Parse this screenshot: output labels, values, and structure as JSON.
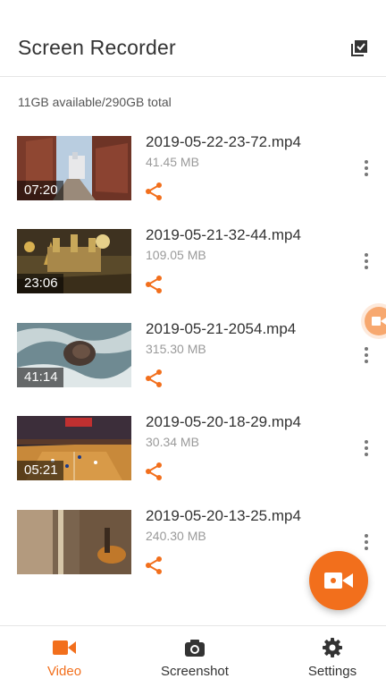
{
  "app": {
    "title": "Screen Recorder"
  },
  "storage": {
    "text": "11GB available/290GB total"
  },
  "videos": [
    {
      "filename": "2019-05-22-23-72.mp4",
      "size": "41.45 MB",
      "duration": "07:20"
    },
    {
      "filename": "2019-05-21-32-44.mp4",
      "size": "109.05 MB",
      "duration": "23:06"
    },
    {
      "filename": "2019-05-21-2054.mp4",
      "size": "315.30 MB",
      "duration": "41:14"
    },
    {
      "filename": "2019-05-20-18-29.mp4",
      "size": "30.34 MB",
      "duration": "05:21"
    },
    {
      "filename": "2019-05-20-13-25.mp4",
      "size": "240.30 MB",
      "duration": ""
    }
  ],
  "nav": {
    "video": "Video",
    "screenshot": "Screenshot",
    "settings": "Settings"
  },
  "colors": {
    "accent": "#f26f1c",
    "text": "#333333",
    "muted": "#9a9a9a"
  },
  "icons": {
    "select": "checkbox-stack-icon",
    "share": "share-icon",
    "more": "more-vertical-icon",
    "fab": "video-camera-icon"
  }
}
